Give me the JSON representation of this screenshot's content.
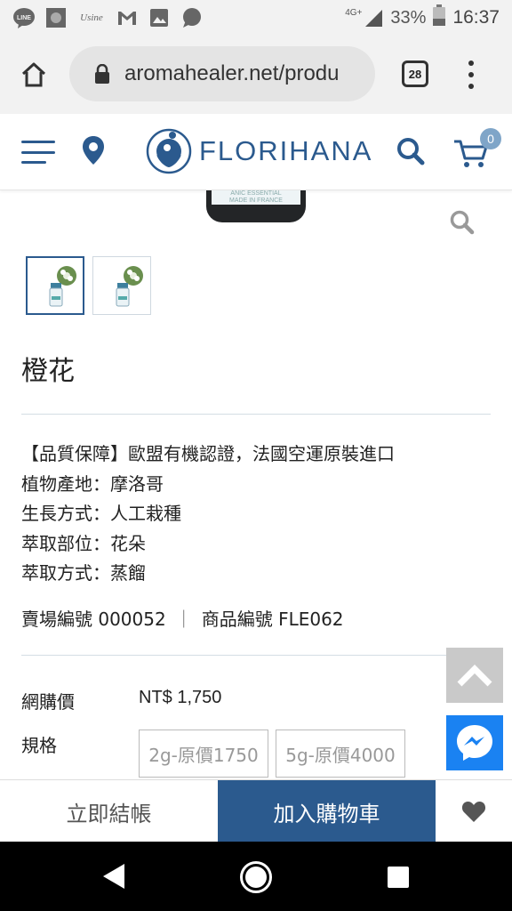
{
  "status_bar": {
    "network": "4G+",
    "battery": "33%",
    "time": "16:37",
    "left_icons": [
      "line-icon",
      "square-app-icon",
      "usine-app-icon",
      "gmail-icon",
      "gallery-icon",
      "messages-icon"
    ],
    "usine_label": "Usine"
  },
  "browser": {
    "url": "aromahealer.net/produ",
    "tab_count": "28"
  },
  "site": {
    "logo_text": "FLORIHANA",
    "cart_count": "0",
    "accent": "#2b5a8e"
  },
  "product": {
    "bottle_label": "ANIC ESSENTIAL\nMADE IN FRANCE",
    "title": "橙花",
    "description": [
      "【品質保障】歐盟有機認證，法國空運原裝進口",
      "植物產地：摩洛哥",
      "生長方式：人工栽種",
      "萃取部位：花朵",
      "萃取方式：蒸餾"
    ],
    "store_code_label": "賣場編號 000052",
    "product_code_label": "商品編號 FLE062",
    "separator": "｜",
    "price_label": "網購價",
    "price": "NT$ 1,750",
    "spec_label": "規格",
    "options": [
      "2g-原價1750",
      "5g-原價4000"
    ]
  },
  "actions": {
    "checkout": "立即結帳",
    "add_to_cart": "加入購物車"
  }
}
